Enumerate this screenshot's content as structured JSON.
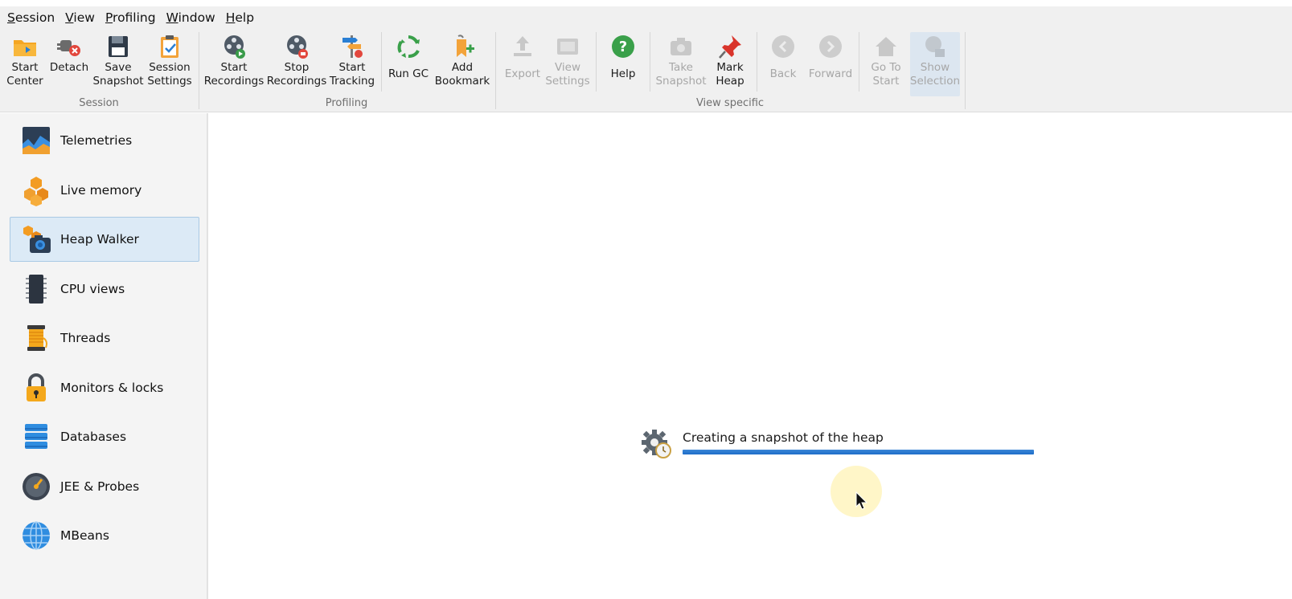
{
  "menu": [
    {
      "label": "Session",
      "mnemonic": "S",
      "rest": "ession"
    },
    {
      "label": "View",
      "mnemonic": "V",
      "rest": "iew"
    },
    {
      "label": "Profiling",
      "mnemonic": "P",
      "rest": "rofiling"
    },
    {
      "label": "Window",
      "mnemonic": "W",
      "rest": "indow"
    },
    {
      "label": "Help",
      "mnemonic": "H",
      "rest": "elp"
    }
  ],
  "toolbar": {
    "groups": {
      "session": "Session",
      "profiling": "Profiling",
      "view_specific": "View specific"
    },
    "buttons": {
      "start_center": "Start\nCenter",
      "detach": "Detach",
      "save_snapshot": "Save\nSnapshot",
      "session_settings": "Session\nSettings",
      "start_recordings": "Start\nRecordings",
      "stop_recordings": "Stop\nRecordings",
      "start_tracking": "Start\nTracking",
      "run_gc": "Run GC",
      "add_bookmark": "Add\nBookmark",
      "export": "Export",
      "view_settings": "View\nSettings",
      "help": "Help",
      "take_snapshot": "Take\nSnapshot",
      "mark_heap": "Mark\nHeap",
      "back": "Back",
      "forward": "Forward",
      "go_to_start": "Go To\nStart",
      "show_selection": "Show\nSelection"
    }
  },
  "sidebar": {
    "selected": "Heap Walker",
    "items": [
      {
        "label": "Telemetries",
        "icon": "telemetries-icon"
      },
      {
        "label": "Live memory",
        "icon": "live-memory-icon"
      },
      {
        "label": "Heap Walker",
        "icon": "heap-walker-icon"
      },
      {
        "label": "CPU views",
        "icon": "cpu-icon"
      },
      {
        "label": "Threads",
        "icon": "threads-icon"
      },
      {
        "label": "Monitors & locks",
        "icon": "lock-icon"
      },
      {
        "label": "Databases",
        "icon": "database-icon"
      },
      {
        "label": "JEE & Probes",
        "icon": "gauge-icon"
      },
      {
        "label": "MBeans",
        "icon": "globe-icon"
      }
    ]
  },
  "progress": {
    "message": "Creating a snapshot of the heap",
    "fraction": 1.0
  },
  "colors": {
    "accent": "#1e6dc9",
    "selection_bg": "#dceaf6",
    "toolbar_bg": "#f0f0f0"
  }
}
